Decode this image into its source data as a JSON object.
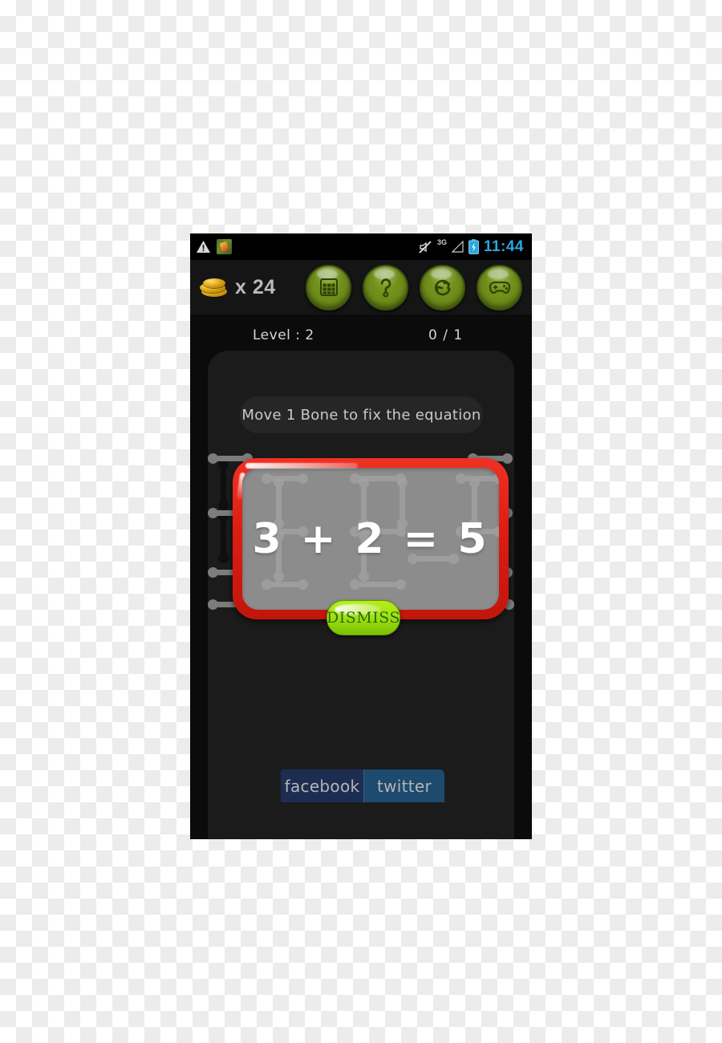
{
  "statusbar": {
    "warning_icon": "warning-triangle-icon",
    "app_icon": "app-notification-icon",
    "mute_icon": "mute-icon",
    "network_label": "3G",
    "signal_icon": "signal-bars-icon",
    "battery_icon": "battery-charging-icon",
    "time": "11:44"
  },
  "hud": {
    "coin_icon": "coin-stack-icon",
    "coin_count": "x 24",
    "buttons": [
      {
        "name": "levels-grid-button",
        "icon": "grid-icon"
      },
      {
        "name": "hint-button",
        "icon": "question-mark-icon"
      },
      {
        "name": "restart-button",
        "icon": "refresh-icon"
      },
      {
        "name": "more-games-button",
        "icon": "gamepad-icon"
      }
    ]
  },
  "game": {
    "level_label": "Level : 2",
    "score_label": "0 / 1",
    "hint_text": "Move 1 Bone to fix the equation",
    "equation": "3 + 2 = 5",
    "dismiss_label": "DISMISS"
  },
  "social": {
    "facebook_label": "facebook",
    "twitter_label": "twitter"
  },
  "colors": {
    "accent_red": "#dd1d12",
    "accent_green": "#9fe010",
    "hud_green": "#6b8a19",
    "facebook_blue": "#1d2d52",
    "twitter_blue": "#1d4a6e",
    "time_blue": "#2aa7e0",
    "panel_dark": "#1b1b1b",
    "device_black": "#0a0a0a"
  }
}
